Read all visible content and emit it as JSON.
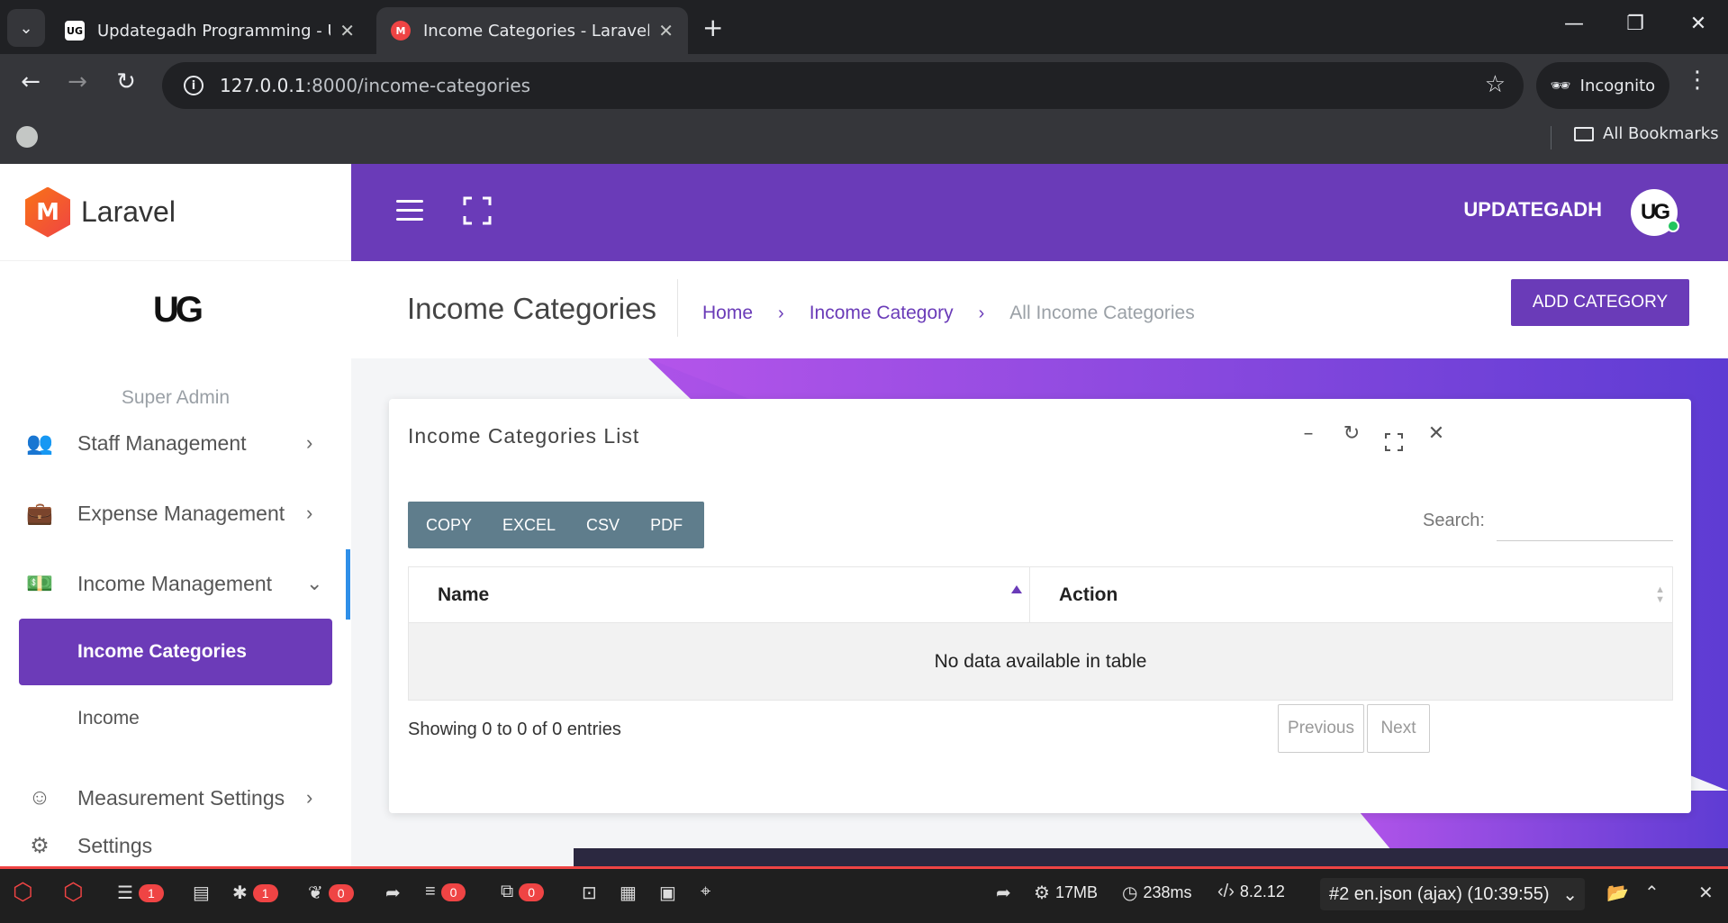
{
  "browser": {
    "tabs": [
      {
        "title": "Updategadh Programming - Up",
        "favicon": "ug-logo",
        "active": false
      },
      {
        "title": "Income Categories - Laravel",
        "favicon": "laravel-logo",
        "active": true
      }
    ],
    "url_host": "127.0.0.1",
    "url_path": ":8000/income-categories",
    "incognito_label": "Incognito",
    "bookmarks_label": "All Bookmarks"
  },
  "sidebar": {
    "brand_letter": "M",
    "brand_name": "Laravel",
    "user_logo": "UG",
    "user_role": "Super Admin",
    "items": [
      {
        "label": "Staff Management",
        "icon": "users-icon"
      },
      {
        "label": "Expense Management",
        "icon": "briefcase-icon"
      },
      {
        "label": "Income Management",
        "icon": "money-icon",
        "expanded": true
      },
      {
        "label": "Measurement Settings",
        "icon": "face-icon"
      },
      {
        "label": "Settings",
        "icon": "gear-icon"
      }
    ],
    "submenu": {
      "active": "Income Categories",
      "other": "Income"
    }
  },
  "topbar": {
    "username": "UPDATEGADH",
    "avatar": "UG",
    "status_color": "#22c55e"
  },
  "page": {
    "title": "Income Categories",
    "breadcrumb": [
      "Home",
      "Income Category",
      "All Income Categories"
    ],
    "add_button": "ADD CATEGORY"
  },
  "card": {
    "title": "Income Categories List",
    "export_buttons": [
      "COPY",
      "EXCEL",
      "CSV",
      "PDF"
    ],
    "search_label": "Search:",
    "search_value": "",
    "columns": [
      "Name",
      "Action"
    ],
    "empty_text": "No data available in table",
    "info": "Showing 0 to 0 of 0 entries",
    "pagination": {
      "previous": "Previous",
      "next": "Next"
    }
  },
  "debugbar": {
    "messages": "1",
    "exceptions": "1",
    "views": "0",
    "queries": "0",
    "models": "0",
    "memory": "17MB",
    "time": "238ms",
    "php_version": "8.2.12",
    "request": "#2 en.json (ajax) (10:39:55)"
  },
  "colors": {
    "accent": "#6a3bb8",
    "banner_start": "#a94ee6",
    "banner_end": "#6a3bd4",
    "export_group": "#5f7d8c",
    "active_indicator": "#2f8fe8",
    "debug_badge": "#ef4444"
  }
}
